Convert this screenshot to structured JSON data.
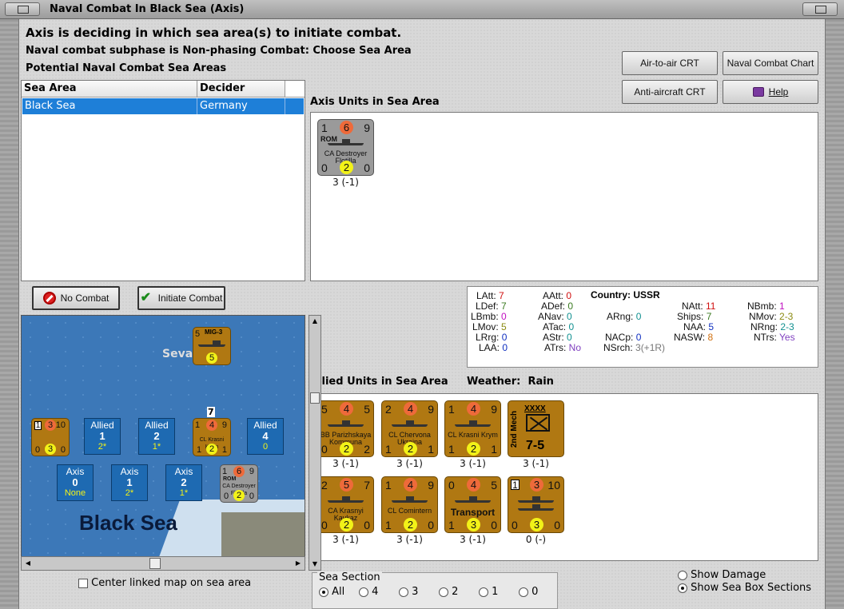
{
  "window": {
    "title": "Naval Combat In Black Sea (Axis)"
  },
  "header": {
    "line1": "Axis is deciding in which sea area(s) to initiate combat.",
    "line2": "Naval combat subphase is Non-phasing Combat: Choose Sea Area",
    "line3": "Potential Naval Combat Sea Areas"
  },
  "buttons": {
    "air_crt": "Air-to-air CRT",
    "naval_chart": "Naval Combat Chart",
    "aa_crt": "Anti-aircraft CRT",
    "help": "Help",
    "no_combat": "No Combat",
    "initiate": "Initiate Combat"
  },
  "sea_table": {
    "headers": [
      "Sea Area",
      "Decider"
    ],
    "rows": [
      {
        "area": "Black Sea",
        "decider": "Germany"
      }
    ]
  },
  "axis_units": {
    "title": "Axis Units in Sea Area",
    "unit": {
      "tl": "1",
      "tt": "6",
      "tr": "9",
      "nat": "ROM",
      "name": "CA Destroyer Flotilla",
      "bl": "0",
      "tb": "2",
      "br": "0",
      "label": "3 (-1)"
    }
  },
  "stats": {
    "country_label": "Country:",
    "country": "USSR",
    "LAtt": "7",
    "LDef": "7",
    "LBmb": "0",
    "LMov": "5",
    "LRrg": "0",
    "LAA": "0",
    "AAtt": "0",
    "ADef": "0",
    "ANav": "0",
    "ATac": "0",
    "AStr": "0",
    "ATrs": "No",
    "ARng": "0",
    "NACp": "0",
    "NSrch": "3(+1R)",
    "NAtt": "11",
    "Ships": "7",
    "NAA": "5",
    "NASW": "8",
    "NBmb": "1",
    "NMov": "2-3",
    "NRng": "2-3",
    "NTrs": "Yes"
  },
  "allied_units": {
    "title": "Allied Units in Sea Area",
    "weather_label": "Weather:",
    "weather": "Rain",
    "units": [
      {
        "tl": "5",
        "tt": "4",
        "tr": "5",
        "name": "BB Parizhskaya Kommuna",
        "bl": "0",
        "tb": "2",
        "br": "2",
        "label": "3 (-1)"
      },
      {
        "tl": "2",
        "tt": "4",
        "tr": "9",
        "name": "CL Chervona Ukraina",
        "bl": "1",
        "tb": "2",
        "br": "1",
        "label": "3 (-1)"
      },
      {
        "tl": "1",
        "tt": "4",
        "tr": "9",
        "name": "CL Krasni Krym",
        "bl": "1",
        "tb": "2",
        "br": "1",
        "label": "3 (-1)"
      },
      {
        "type": "army",
        "xxxx": "XXXX",
        "vert": "2nd Mech",
        "big": "7-5",
        "label": "3 (-1)"
      },
      {
        "tl": "2",
        "tt": "5",
        "tr": "7",
        "name": "CA Krasnyi Kavkaz",
        "bl": "0",
        "tb": "2",
        "br": "0",
        "label": "3 (-1)"
      },
      {
        "tl": "1",
        "tt": "4",
        "tr": "9",
        "name": "CL Comintern",
        "bl": "1",
        "tb": "2",
        "br": "0",
        "label": "3 (-1)"
      },
      {
        "tl": "0",
        "tt": "4",
        "tr": "5",
        "name": "Transport",
        "bl": "1",
        "tb": "3",
        "br": "0",
        "label": "3 (-1)"
      },
      {
        "tl": "1",
        "tt": "3",
        "tr": "10",
        "name": "",
        "bl": "0",
        "tb": "3",
        "br": "0",
        "label": "0 (-)"
      }
    ]
  },
  "map": {
    "title": "Black Sea",
    "city": "Seva",
    "air": {
      "tl": "5",
      "name": "MIG-3",
      "tb": "5"
    },
    "marker": "7",
    "sea_unit": {
      "tl": "1",
      "tt": "3",
      "tr": "10",
      "bl": "0",
      "tb": "3",
      "br": "0"
    },
    "sea_unit2": {
      "tl": "1",
      "tt": "4",
      "tr": "9",
      "name": "CL Krasni Krym",
      "bl": "1",
      "tb": "2",
      "br": "1"
    },
    "sea_unit3": {
      "tl": "1",
      "tt": "6",
      "tr": "9",
      "nat": "ROM",
      "name": "CA Destroyer Flotilla",
      "bl": "0",
      "tb": "2",
      "br": "0"
    },
    "allied_boxes": [
      {
        "side": "Allied",
        "num": "1",
        "val": "2*"
      },
      {
        "side": "Allied",
        "num": "2",
        "val": "1*"
      },
      {
        "side": "Allied",
        "num": "4",
        "val": "0"
      }
    ],
    "axis_boxes": [
      {
        "side": "Axis",
        "num": "0",
        "val": "None"
      },
      {
        "side": "Axis",
        "num": "1",
        "val": "2*"
      },
      {
        "side": "Axis",
        "num": "2",
        "val": "1*"
      }
    ]
  },
  "center_label": "Center linked map on sea area",
  "sea_section": {
    "label": "Sea Section",
    "options": [
      "All",
      "4",
      "3",
      "2",
      "1",
      "0"
    ]
  },
  "show_damage": "Show Damage",
  "show_boxes": "Show Sea Box Sections"
}
